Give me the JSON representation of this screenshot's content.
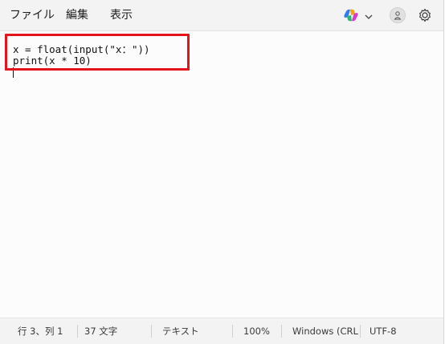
{
  "menu": {
    "file": "ファイル",
    "edit": "編集",
    "view": "表示"
  },
  "toolbar": {
    "copilot_icon": "copilot-icon",
    "chevron_icon": "chevron-down-icon",
    "account_icon": "account-icon",
    "settings_icon": "gear-icon"
  },
  "editor": {
    "lines": [
      "x = float(input(\"x：\"))",
      "print(x * 10)"
    ],
    "highlight_color": "#e3141b"
  },
  "status": {
    "position": "行 3、列 1",
    "char_count": "37 文字",
    "doc_type": "テキスト",
    "zoom": "100%",
    "line_ending": "Windows (CRL",
    "encoding": "UTF-8"
  }
}
